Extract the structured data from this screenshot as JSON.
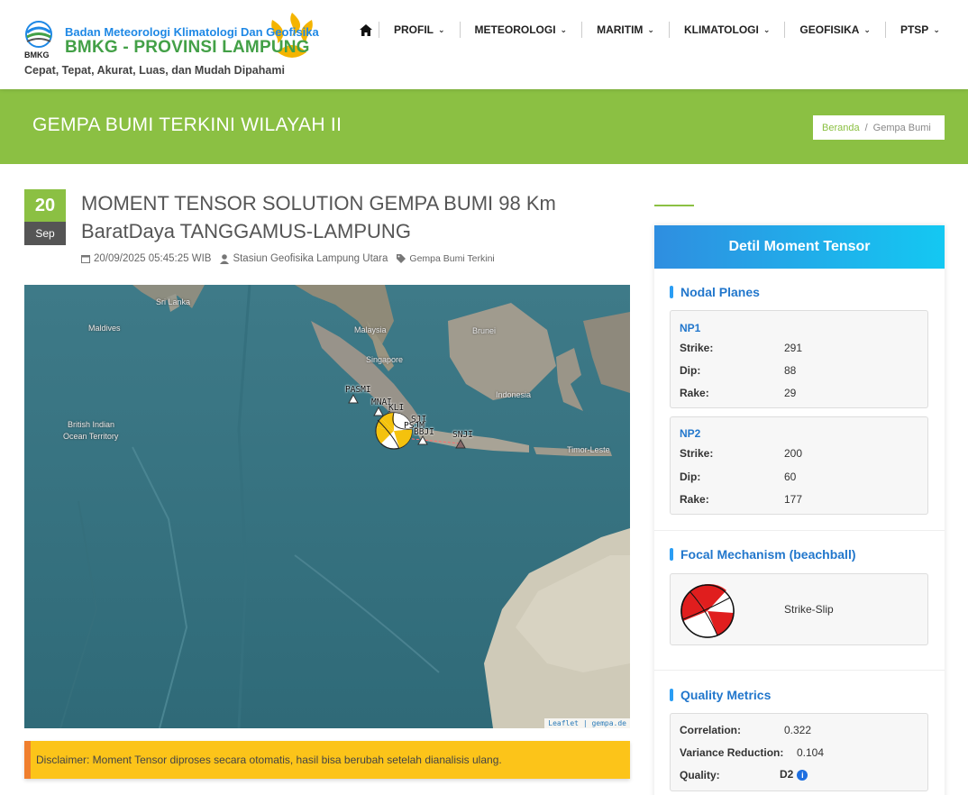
{
  "header": {
    "org_name": "Badan Meteorologi Klimatologi Dan Geofisika",
    "site_name": "BMKG - PROVINSI LAMPUNG",
    "logo_text": "BMKG",
    "tagline": "Cepat, Tepat, Akurat, Luas, dan Mudah Dipahami",
    "nav": [
      {
        "label": "PROFIL"
      },
      {
        "label": "METEOROLOGI"
      },
      {
        "label": "MARITIM"
      },
      {
        "label": "KLIMATOLOGI"
      },
      {
        "label": "GEOFISIKA"
      },
      {
        "label": "PTSP"
      }
    ]
  },
  "banner": {
    "title": "GEMPA BUMI TERKINI WILAYAH II",
    "breadcrumb": {
      "home": "Beranda",
      "separator": "/",
      "current": "Gempa Bumi"
    }
  },
  "article": {
    "date_day": "20",
    "date_month": "Sep",
    "title": "MOMENT TENSOR SOLUTION GEMPA BUMI 98 Km BaratDaya TANGGAMUS-LAMPUNG",
    "datetime": "20/09/2025 05:45:25 WIB",
    "author": "Stasiun Geofisika Lampung Utara",
    "category": "Gempa Bumi Terkini"
  },
  "map": {
    "labels": {
      "sri_lanka": "Sri Lanka",
      "maldives": "Maldives",
      "malaysia": "Malaysia",
      "brunei": "Brunei",
      "singapore": "Singapore",
      "indonesia": "Indonesia",
      "biot_1": "British Indian",
      "biot_2": "Ocean Territory",
      "timor_leste": "Timor-Leste"
    },
    "stations": {
      "pasmi": "PASMI",
      "mnai": "MNAI",
      "kli": "KLI",
      "sji": "SJI",
      "psjm": "PSJM",
      "bbji": "BBJI",
      "snji": "SNJI"
    },
    "attribution": {
      "leaflet": "Leaflet",
      "separator": "|",
      "source": "gempa.de"
    }
  },
  "disclaimer": "Disclaimer: Moment Tensor diproses secara otomatis, hasil bisa berubah setelah dianalisis ulang.",
  "sidebar": {
    "title": "Detil Moment Tensor",
    "nodal_title": "Nodal Planes",
    "np1": {
      "name": "NP1",
      "strike_label": "Strike:",
      "strike": "291",
      "dip_label": "Dip:",
      "dip": "88",
      "rake_label": "Rake:",
      "rake": "29"
    },
    "np2": {
      "name": "NP2",
      "strike_label": "Strike:",
      "strike": "200",
      "dip_label": "Dip:",
      "dip": "60",
      "rake_label": "Rake:",
      "rake": "177"
    },
    "focal_title": "Focal Mechanism (beachball)",
    "mechanism": "Strike-Slip",
    "quality_title": "Quality Metrics",
    "correlation_label": "Correlation:",
    "correlation": "0.322",
    "variance_label": "Variance Reduction:",
    "variance": "0.104",
    "quality_label": "Quality:",
    "quality": "D2"
  },
  "colors": {
    "brand_green": "#8bc043",
    "brand_blue": "#2277cc",
    "disclaimer_bg": "#fcc419",
    "beachball_red": "#e01e1e"
  }
}
